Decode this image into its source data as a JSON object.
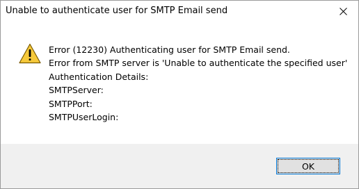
{
  "window": {
    "title": "Unable to authenticate user for SMTP Email send",
    "close_icon": "close-icon"
  },
  "message": {
    "icon": "warning-icon",
    "lines": [
      "Error (12230) Authenticating user for SMTP Email send.",
      "Error from SMTP server is 'Unable to authenticate the specified user'",
      "Authentication Details:",
      "SMTPServer:",
      "SMTPPort:",
      "SMTPUserLogin:"
    ]
  },
  "buttons": {
    "ok_label": "OK"
  },
  "colors": {
    "warning_fill": "#f6c93a",
    "warning_border": "#7a5a00",
    "focus_border": "#0078d7",
    "footer_bg": "#f0f0f0"
  }
}
